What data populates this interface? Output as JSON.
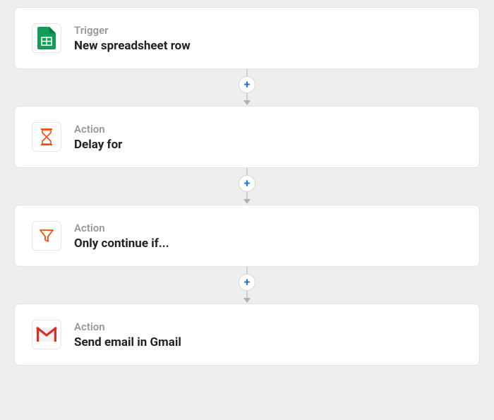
{
  "steps": [
    {
      "type_label": "Trigger",
      "title": "New spreadsheet row",
      "icon": "google-sheets"
    },
    {
      "type_label": "Action",
      "title": "Delay for",
      "icon": "hourglass"
    },
    {
      "type_label": "Action",
      "title": "Only continue if...",
      "icon": "filter"
    },
    {
      "type_label": "Action",
      "title": "Send email in Gmail",
      "icon": "gmail"
    }
  ],
  "add_button_label": "+"
}
